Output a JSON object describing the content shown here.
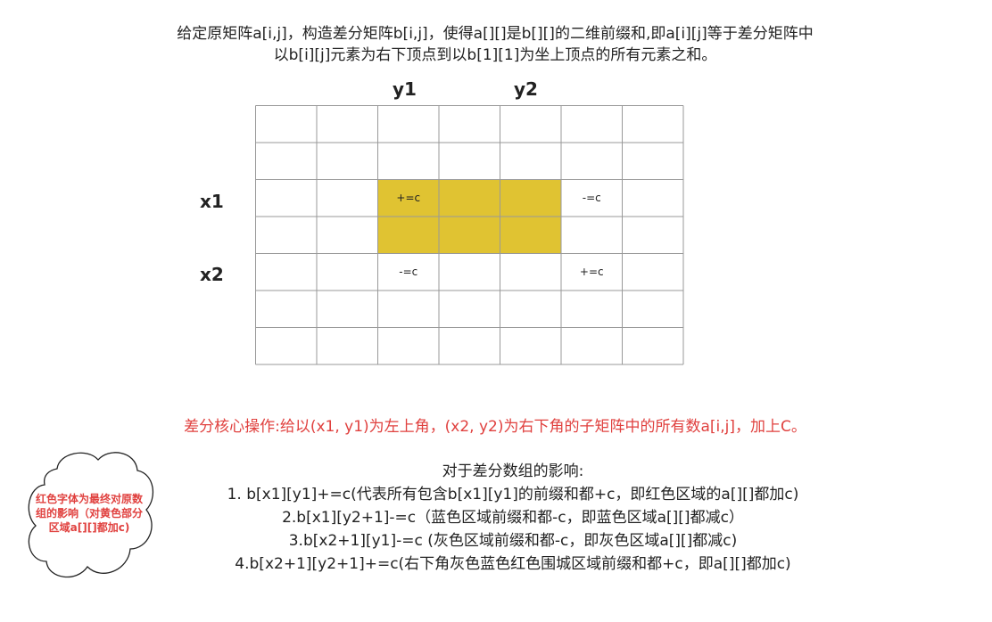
{
  "intro": {
    "line1": "给定原矩阵a[i,j]，构造差分矩阵b[i,j]，使得a[][]是b[][]的二维前缀和,即a[i][j]等于差分矩阵中",
    "line2": "以b[i][j]元素为右下顶点到以b[1][1]为坐上顶点的所有元素之和。"
  },
  "diagram": {
    "col_labels": {
      "y1": "y1",
      "y2": "y2"
    },
    "row_labels": {
      "x1": "x1",
      "x2": "x2"
    },
    "rows": 7,
    "cols": 7,
    "highlight": {
      "row_start": 2,
      "row_end": 3,
      "col_start": 2,
      "col_end": 4,
      "color": "#e0c332"
    },
    "cell_marks": [
      {
        "row": 2,
        "col": 2,
        "text": "+=c"
      },
      {
        "row": 2,
        "col": 5,
        "text": "-=c"
      },
      {
        "row": 4,
        "col": 2,
        "text": "-=c"
      },
      {
        "row": 4,
        "col": 5,
        "text": "+=c"
      }
    ],
    "grid_color": "#999999"
  },
  "core_op": "差分核心操作:给以(x1, y1)为左上角，(x2, y2)为右下角的子矩阵中的所有数a[i,j]，加上C。",
  "effects": {
    "title": "对于差分数组的影响:",
    "items": [
      "1. b[x1][y1]+=c(代表所有包含b[x1][y1]的前缀和都+c，即红色区域的a[][]都加c)",
      "2.b[x1][y2+1]-=c（蓝色区域前缀和都-c，即蓝色区域a[][]都减c）",
      "3.b[x2+1][y1]-=c (灰色区域前缀和都-c，即灰色区域a[][]都减c)",
      "4.b[x2+1][y2+1]+=c(右下角灰色蓝色红色围城区域前缀和都+c，即a[][]都加c)"
    ]
  },
  "cloud_note": "红色字体为最终对原数组的影响（对黄色部分区域a[][]都加c)",
  "colors": {
    "accent_red": "#e0413f",
    "highlight_yellow": "#e0c332",
    "text": "#222222"
  }
}
